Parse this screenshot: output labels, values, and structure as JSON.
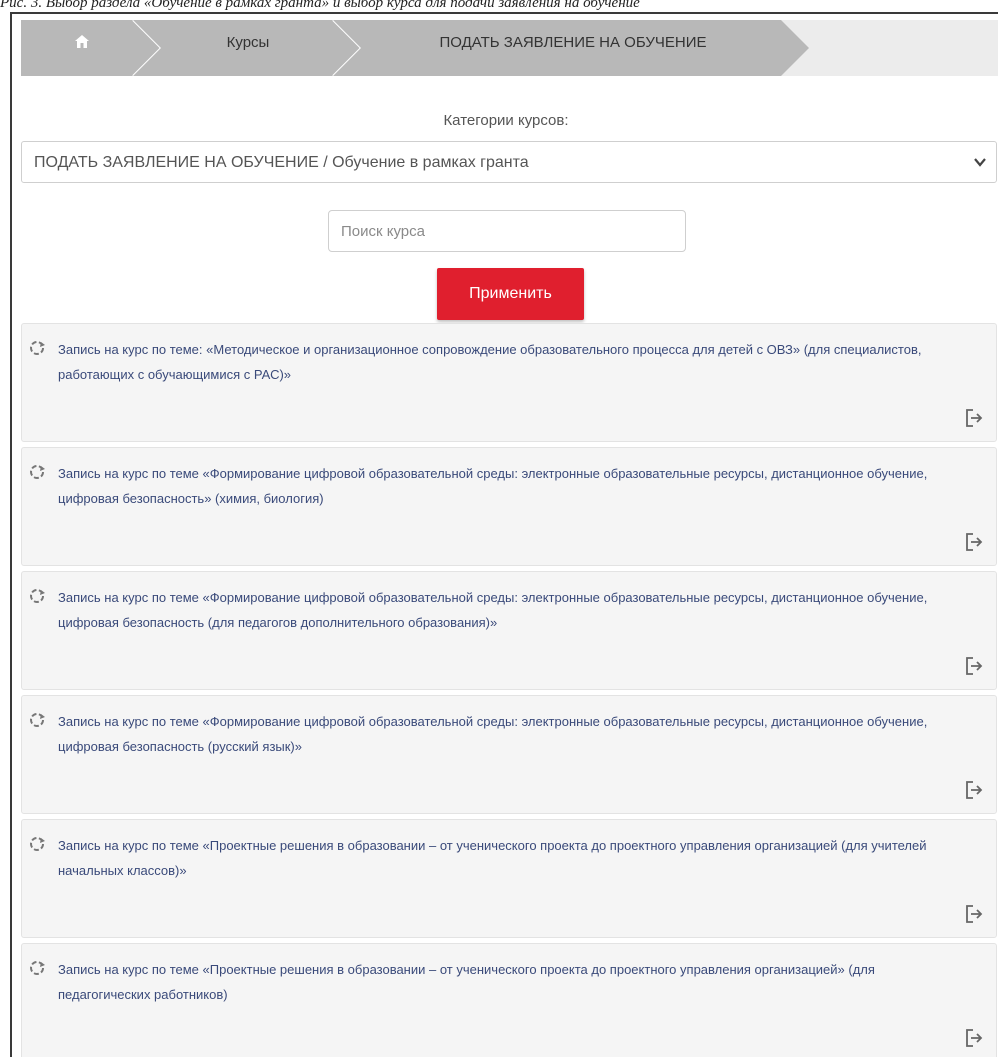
{
  "caption": "Рис. 3. Выбор раздела «Обучение в рамках гранта» и выбор курса для подачи заявления на обучение",
  "breadcrumb": {
    "home_icon": "home-icon",
    "items": [
      {
        "label": "Курсы"
      },
      {
        "label": "ПОДАТЬ ЗАЯВЛЕНИЕ НА ОБУЧЕНИЕ"
      }
    ]
  },
  "filters": {
    "categories_label": "Категории курсов:",
    "category_selected": "ПОДАТЬ ЗАЯВЛЕНИЕ НА ОБУЧЕНИЕ / Обучение в рамках гранта",
    "search_placeholder": "Поиск курса",
    "search_value": "",
    "apply_label": "Применить"
  },
  "colors": {
    "accent": "#e01f2e",
    "breadcrumb_bg": "#b8b8b8",
    "card_bg": "#f5f5f5",
    "link_text": "#3a4a7a"
  },
  "course_icon": "course-icon",
  "enter_icon": "enter-icon",
  "courses": [
    {
      "title": "Запись на курс по теме: «Методическое и организационное сопровождение образовательного процесса для детей с ОВЗ» (для специалистов, работающих с обучающимися с РАС)»"
    },
    {
      "title": "Запись на курс по теме «Формирование цифровой образовательной среды: электронные образовательные ресурсы, дистанционное обучение, цифровая безопасность» (химия, биология)"
    },
    {
      "title": "Запись на курс по теме «Формирование цифровой образовательной среды: электронные образовательные ресурсы, дистанционное обучение, цифровая безопасность (для педагогов дополнительного образования)»"
    },
    {
      "title": "Запись на курс по теме «Формирование цифровой образовательной среды: электронные образовательные ресурсы, дистанционное обучение, цифровая безопасность (русский язык)»"
    },
    {
      "title": "Запись на курс по теме «Проектные решения в образовании – от ученического проекта до проектного управления организацией (для учителей начальных классов)»"
    },
    {
      "title": "Запись на курс по теме «Проектные решения в образовании – от ученического проекта до проектного управления организацией» (для педагогических работников)"
    }
  ]
}
